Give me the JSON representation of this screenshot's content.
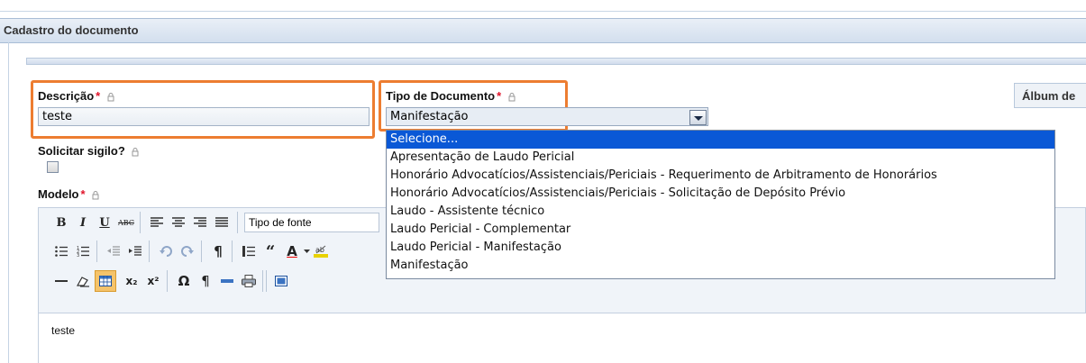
{
  "panel": {
    "title": "Cadastro do documento"
  },
  "album_tab": {
    "label": "Álbum de"
  },
  "descricao": {
    "label": "Descrição",
    "required_mark": "*",
    "value": "teste"
  },
  "tipo": {
    "label": "Tipo de Documento",
    "required_mark": "*",
    "value": "Manifestação",
    "options": [
      "Selecione...",
      "Apresentação de Laudo Pericial",
      "Honorário Advocatícios/Assistenciais/Periciais - Requerimento de Arbitramento de Honorários",
      "Honorário Advocatícios/Assistenciais/Periciais - Solicitação de Depósito Prévio",
      "Laudo - Assistente técnico",
      "Laudo Pericial - Complementar",
      "Laudo Pericial - Manifestação",
      "Manifestação"
    ],
    "highlighted_index": 0
  },
  "sigilo": {
    "label": "Solicitar sigilo?",
    "checked": false
  },
  "modelo": {
    "label": "Modelo",
    "required_mark": "*"
  },
  "toolbar": {
    "bold": "B",
    "italic": "I",
    "underline": "U",
    "strike": "ABC",
    "font_select": "Tipo de fonte",
    "quote": "“",
    "font_color": "A",
    "superscript": "x²",
    "subscript": "x₂",
    "omega": "Ω",
    "pilcrow": "¶"
  },
  "editor": {
    "content": "teste"
  },
  "colors": {
    "highlight": "#ed7d31",
    "selected_option": "#0a58d6",
    "required": "#e0142a"
  }
}
